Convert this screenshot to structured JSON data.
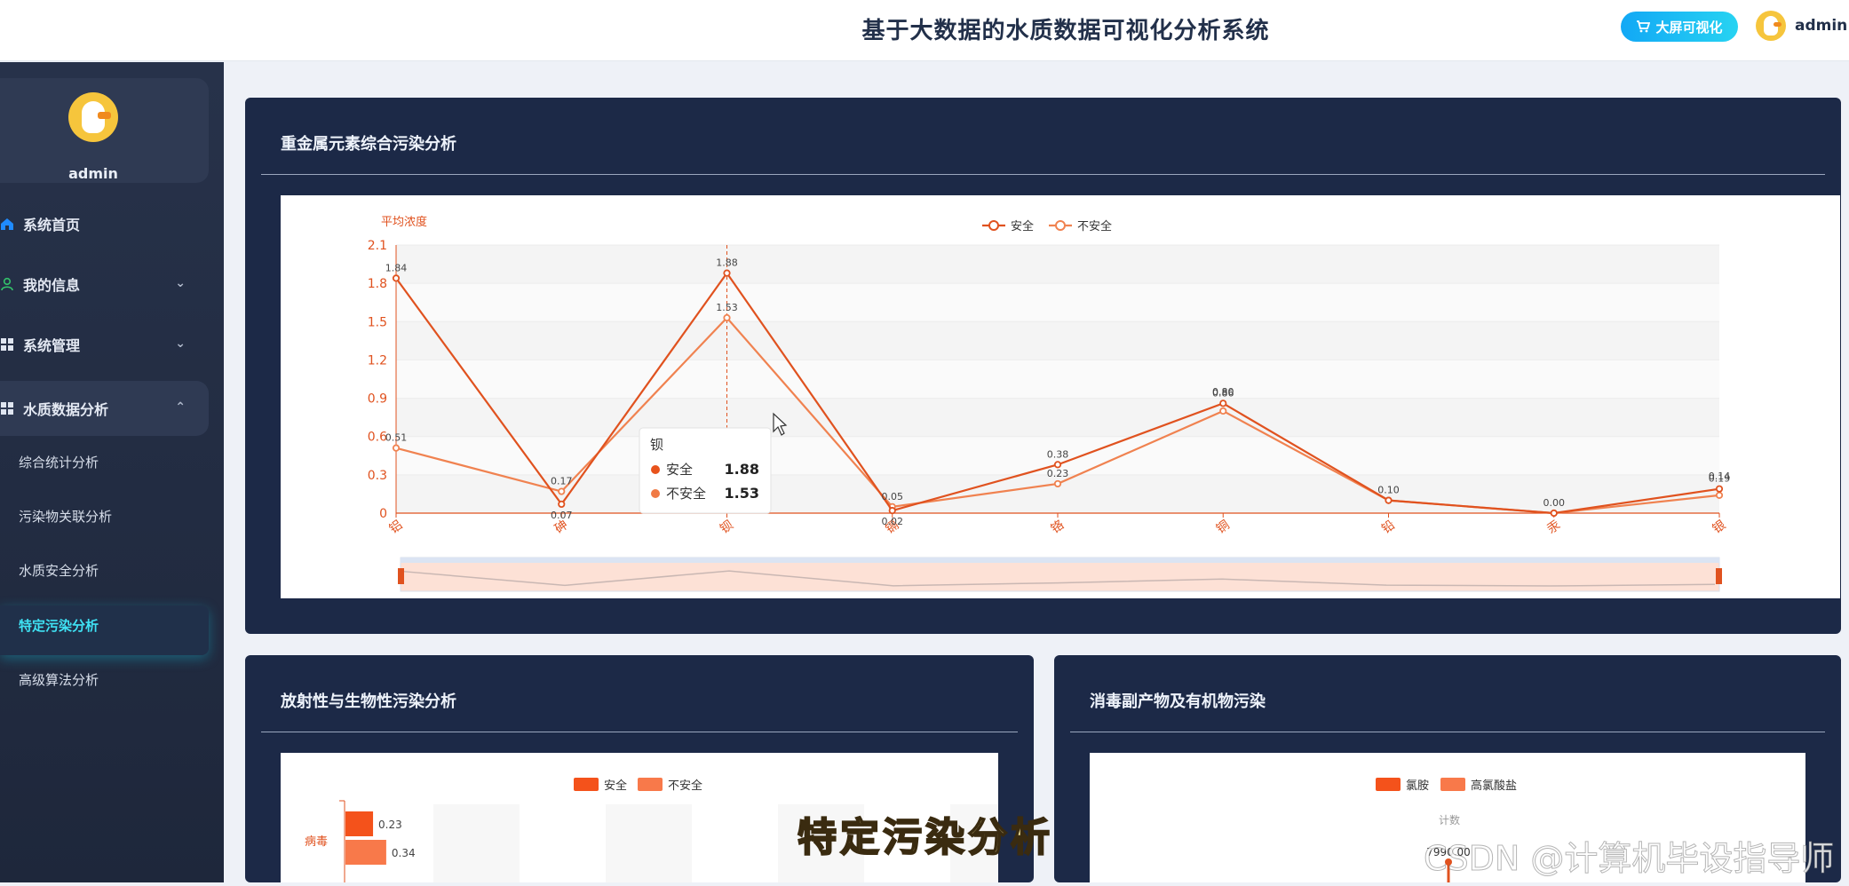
{
  "header": {
    "title": "基于大数据的水质数据可视化分析系统",
    "bigscreen_label": "大屏可视化",
    "username": "admin",
    "bigscreen_icon": "cart-icon",
    "user_dropdown_icon": "chevron-down-icon"
  },
  "sidebar": {
    "profile_name": "admin",
    "items": [
      {
        "label": "系统首页",
        "icon": "home-icon"
      },
      {
        "label": "我的信息",
        "icon": "user-icon"
      },
      {
        "label": "系统管理",
        "icon": "grid-icon"
      },
      {
        "label": "水质数据分析",
        "icon": "grid-icon"
      }
    ],
    "subitems": [
      "综合统计分析",
      "污染物关联分析",
      "水质安全分析",
      "特定污染分析",
      "高级算法分析"
    ],
    "active_subitem": "特定污染分析"
  },
  "panels": {
    "heavy_metal": {
      "title": "重金属元素综合污染分析"
    },
    "radio_bio": {
      "title": "放射性与生物性污染分析"
    },
    "disinfection": {
      "title": "消毒副产物及有机物污染"
    }
  },
  "tooltip": {
    "category": "钡",
    "rows": [
      {
        "name": "安全",
        "value": "1.88",
        "color": "#e8531c"
      },
      {
        "name": "不安全",
        "value": "1.53",
        "color": "#f07a45"
      }
    ]
  },
  "overlay": {
    "caption": "特定污染分析",
    "watermark": "CSDN @计算机毕设指导师"
  },
  "chart_data": [
    {
      "type": "line",
      "ylabel": "平均浓度",
      "categories": [
        "铝",
        "砷",
        "钡",
        "镉",
        "铬",
        "铜",
        "铅",
        "汞",
        "银"
      ],
      "ylim": [
        0,
        2.1
      ],
      "yticks": [
        "0",
        "0.3",
        "0.6",
        "0.9",
        "1.2",
        "1.5",
        "1.8",
        "2.1"
      ],
      "legend_position": "top-center",
      "series": [
        {
          "name": "安全",
          "color": "#e0521f",
          "values": [
            1.84,
            0.07,
            1.88,
            0.02,
            0.38,
            0.86,
            0.1,
            0.0,
            0.19
          ]
        },
        {
          "name": "不安全",
          "color": "#f08250",
          "values": [
            0.51,
            0.17,
            1.53,
            0.05,
            0.23,
            0.8,
            0.1,
            0.0,
            0.14
          ]
        }
      ],
      "value_labels": [
        [
          "1.84",
          "0.07",
          "1.88",
          "0.02",
          "0.38",
          "0.86",
          "0.10",
          "0.00",
          "0.19"
        ],
        [
          "0.51",
          "0.17",
          "1.53",
          "0.05",
          "0.23",
          "0.80",
          "",
          "",
          "0.14"
        ]
      ],
      "datazoom": "bottom"
    },
    {
      "type": "bar",
      "orientation": "horizontal",
      "categories": [
        "病毒"
      ],
      "legend_position": "top-center",
      "series": [
        {
          "name": "安全",
          "color": "#f4521b",
          "values": [
            0.23
          ]
        },
        {
          "name": "不安全",
          "color": "#f8794a",
          "values": [
            0.34
          ]
        }
      ]
    },
    {
      "type": "line",
      "ylabel": "计数",
      "legend_position": "top-center",
      "series": [
        {
          "name": "氯胺",
          "color": "#f4521b"
        },
        {
          "name": "高氯酸盐",
          "color": "#f8794a"
        }
      ],
      "value_labels": [
        "7990.00"
      ]
    }
  ]
}
